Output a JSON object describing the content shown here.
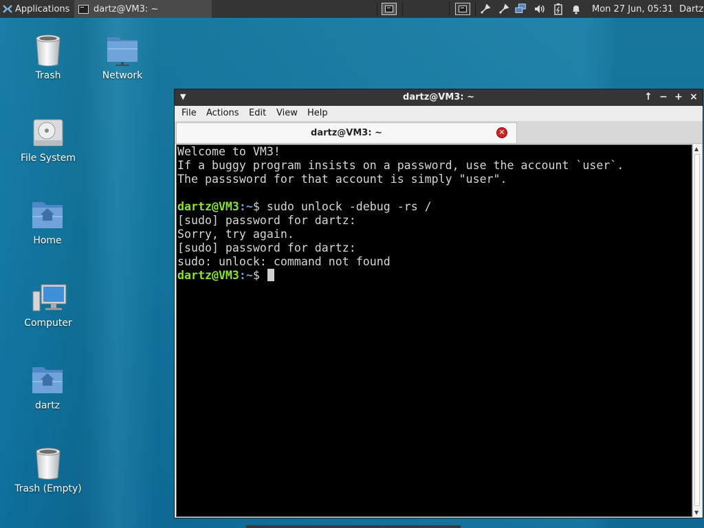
{
  "panel": {
    "applications_label": "Applications",
    "task_label": "dartz@VM3: ~",
    "clock": "Mon 27 Jun, 05:31",
    "user": "Dartz"
  },
  "desktop": {
    "icons": [
      {
        "label": "Trash"
      },
      {
        "label": "Network"
      },
      {
        "label": "File System"
      },
      {
        "label": "Home"
      },
      {
        "label": "Computer"
      },
      {
        "label": "dartz"
      },
      {
        "label": "Trash (Empty)"
      }
    ]
  },
  "window": {
    "title": "dartz@VM3: ~",
    "menu": [
      "File",
      "Actions",
      "Edit",
      "View",
      "Help"
    ],
    "tab_label": "dartz@VM3: ~",
    "controls": [
      "↑",
      "−",
      "+",
      "×"
    ]
  },
  "terminal": {
    "welcome_lines": [
      "Welcome to VM3!",
      "If a buggy program insists on a password, use the account `user`.",
      "The passsword for that account is simply \"user\"."
    ],
    "prompt_host": "dartz@VM3",
    "prompt_path": ":~",
    "prompt_symbol": "$",
    "command": " sudo unlock -debug -rs /",
    "output_lines": [
      "[sudo] password for dartz:",
      "Sorry, try again.",
      "[sudo] password for dartz:",
      "sudo: unlock: command not found"
    ],
    "colors": {
      "host": "#8ae234",
      "path": "#729fcf",
      "text": "#d6d6d6",
      "background": "#000000"
    }
  }
}
